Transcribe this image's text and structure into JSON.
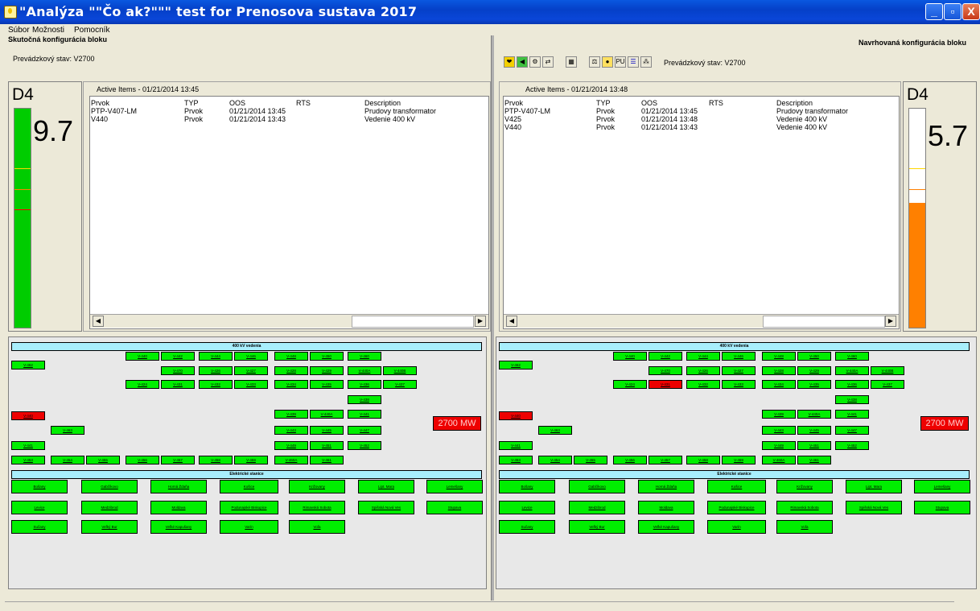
{
  "window": {
    "title": "\"Analýza \"\"Čo ak?\"\"\" test for Prenosova sustava 2017",
    "minimize": "_",
    "restore": "▫",
    "close": "X"
  },
  "menu": [
    {
      "label": "Súbor"
    },
    {
      "label": "Možnosti"
    },
    {
      "label": "Pomocník"
    }
  ],
  "left": {
    "section_title": "Skutočná konfigurácia bloku",
    "state": "Prevádzkový stav: V2700",
    "gauge": {
      "label": "D4",
      "value": "9.7",
      "level": 1.0,
      "fill_color": "#00cc00"
    },
    "list_title": "Active Items - 01/21/2014 13:45",
    "columns": [
      "Prvok",
      "TYP",
      "OOS",
      "RTS",
      "Description"
    ],
    "rows": [
      [
        "PTP-V407-LM",
        "Prvok",
        "01/21/2014 13:45",
        "",
        "Prudovy transformator"
      ],
      [
        "V440",
        "Prvok",
        "01/21/2014 13:43",
        "",
        "Vedenie 400 kV"
      ]
    ],
    "mw": "2700 MW"
  },
  "right": {
    "section_title": "Navrhovaná konfigurácia bloku",
    "state": "Prevádzkový stav: V2700",
    "toolbar_pu": "PU",
    "gauge": {
      "label": "D4",
      "value": "5.7",
      "level": 0.57,
      "fill_color": "#ff8000"
    },
    "list_title": "Active Items - 01/21/2014 13:48",
    "columns": [
      "Prvok",
      "TYP",
      "OOS",
      "RTS",
      "Description"
    ],
    "rows": [
      [
        "PTP-V407-LM",
        "Prvok",
        "01/21/2014 13:45",
        "",
        "Prudovy transformator"
      ],
      [
        "V425",
        "Prvok",
        "01/21/2014 13:48",
        "",
        "Vedenie 400 kV"
      ],
      [
        "V440",
        "Prvok",
        "01/21/2014 13:43",
        "",
        "Vedenie 400 kV"
      ]
    ],
    "mw": "2700 MW"
  },
  "diagram": {
    "lines_header": "400 kV vedenia",
    "stations_header": "Elektrické stanice",
    "line_labels": [
      "V-440",
      "V-442",
      "V-424",
      "V-444",
      "V-446",
      "V-448",
      "V-450",
      "V-460",
      "V-470",
      "V-426",
      "V-427",
      "V-428",
      "V-429",
      "V-431",
      "V-432",
      "V-433",
      "V-434",
      "V-435",
      "V-436",
      "V-437",
      "V-438",
      "V-439",
      "V-440A",
      "V-440B",
      "V-441",
      "V-443",
      "V-445",
      "V-447",
      "V-449",
      "V-451",
      "V-452",
      "V-453",
      "V-454",
      "V-455",
      "V-456",
      "V-457",
      "V-458",
      "V-459",
      "V-460A",
      "V-461",
      "V-462",
      "V-463"
    ],
    "stations": [
      "Bošany",
      "Gabčíkovo",
      "Horná Ždaňa",
      "Košice",
      "Križovany",
      "Lipt. Mara",
      "Lemešany",
      "Levice",
      "Medzibrod",
      "Moldava",
      "Podunajské Biskupice",
      "Rimavská Sobota",
      "Spišská Nová Ves",
      "Stupava",
      "Sučany",
      "Veľký Bur",
      "Veľké Kapušany",
      "Varín",
      "Voľa"
    ]
  }
}
